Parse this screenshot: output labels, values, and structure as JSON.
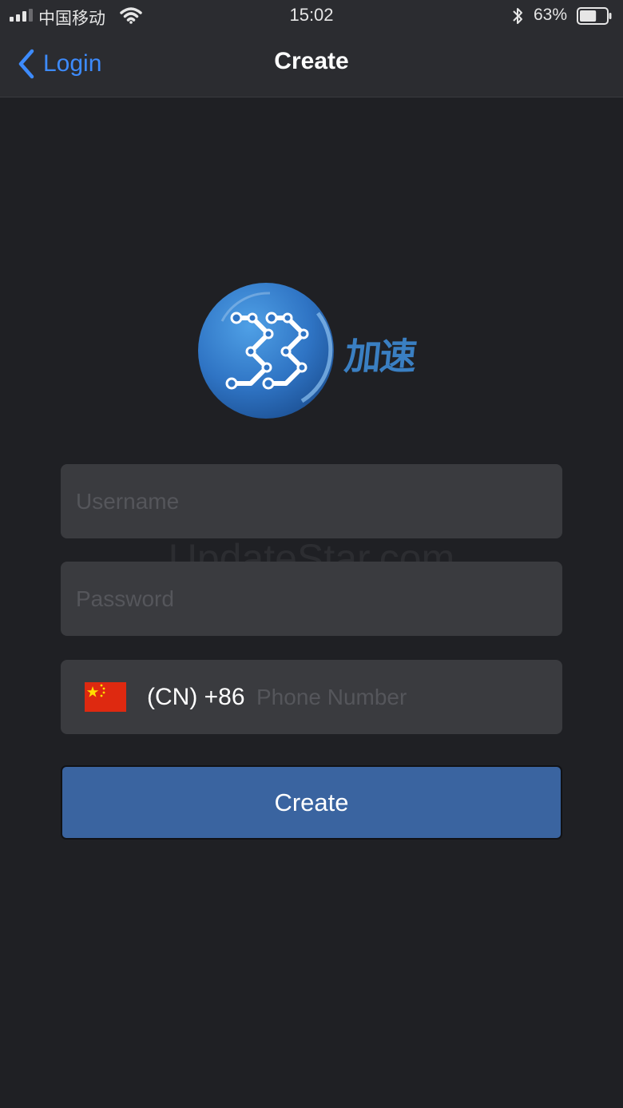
{
  "status_bar": {
    "carrier": "中国移动",
    "time": "15:02",
    "battery_percent": "63%",
    "battery_level": 0.63
  },
  "nav": {
    "back_label": "Login",
    "title": "Create"
  },
  "logo": {
    "text": "加速"
  },
  "watermark": "UpdateStar.com",
  "form": {
    "username_placeholder": "Username",
    "username_value": "",
    "password_placeholder": "Password",
    "password_value": "",
    "country_code": "(CN) +86",
    "phone_placeholder": "Phone Number",
    "phone_value": "",
    "create_label": "Create"
  },
  "colors": {
    "background": "#1f2024",
    "bar": "#2b2c30",
    "field": "#3a3b3f",
    "accent_link": "#3d8bfd",
    "button": "#3a64a0"
  }
}
